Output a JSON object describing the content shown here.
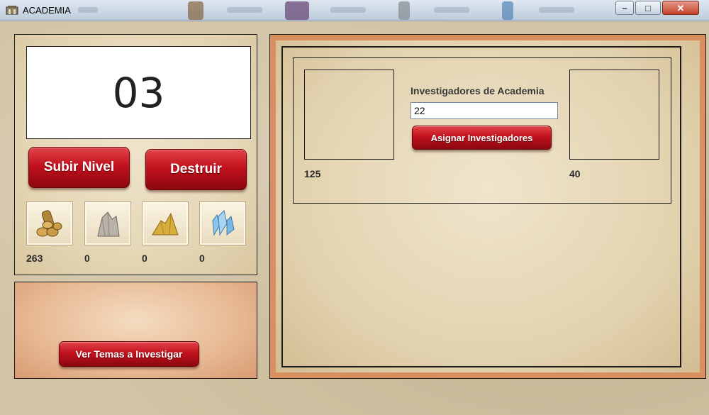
{
  "window": {
    "title": "ACADEMIA",
    "controls": {
      "minimize": "–",
      "maximize": "□",
      "close": "✕"
    }
  },
  "left_panel": {
    "level_display": "03",
    "buttons": {
      "upgrade_label": "Subir Nivel",
      "destroy_label": "Destruir"
    },
    "resources": [
      {
        "icon": "wood-icon",
        "value": "263"
      },
      {
        "icon": "stone-icon",
        "value": "0"
      },
      {
        "icon": "sulfur-icon",
        "value": "0"
      },
      {
        "icon": "crystal-icon",
        "value": "0"
      }
    ]
  },
  "bottom_left_panel": {
    "view_topics_label": "Ver Temas a Investigar"
  },
  "right_panel": {
    "researchers_label": "Investigadores de Academia",
    "researchers_input_value": "22",
    "assign_button_label": "Asignar Investigadores",
    "left_value": "125",
    "right_value": "40"
  },
  "colors": {
    "button_red": "#c1121d",
    "parchment": "#e6d8b8",
    "panel_border_orange": "#d98f60",
    "bottom_panel_peach": "#e7b993"
  }
}
